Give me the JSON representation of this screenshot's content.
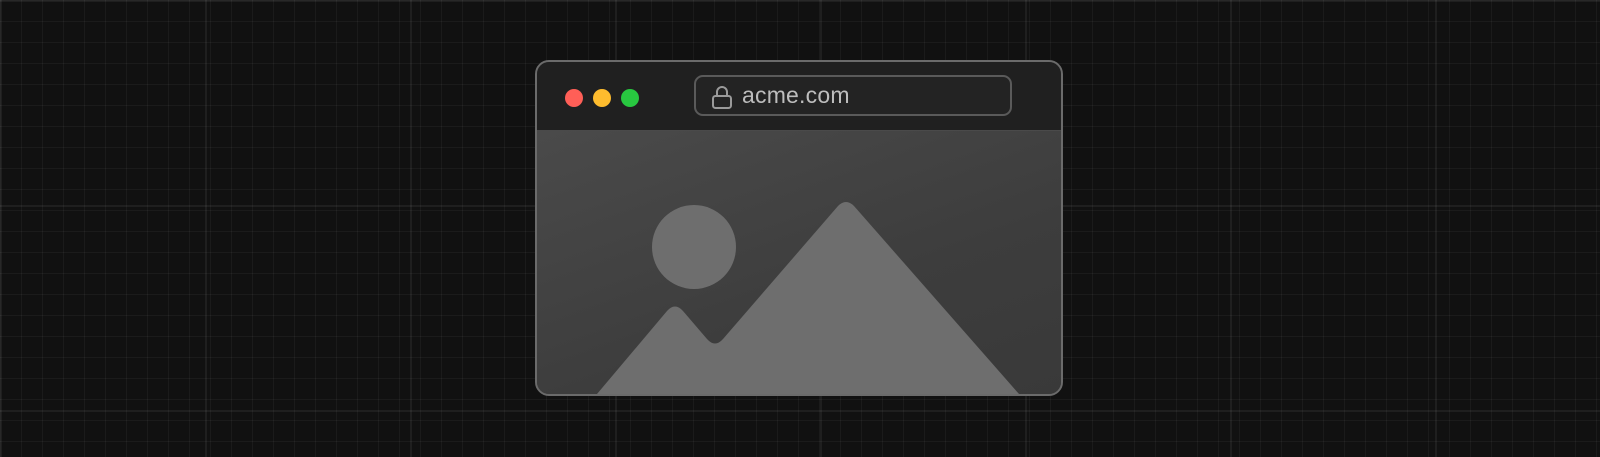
{
  "background": {
    "color": "#111111"
  },
  "browser": {
    "traffic_lights": {
      "close_color": "#ff5f57",
      "minimize_color": "#febc2e",
      "maximize_color": "#28c840"
    },
    "address_bar": {
      "icon": "lock-icon",
      "url": "acme.com"
    },
    "content": {
      "icon": "image-placeholder-icon",
      "shape_color": "#6e6e6e"
    }
  }
}
